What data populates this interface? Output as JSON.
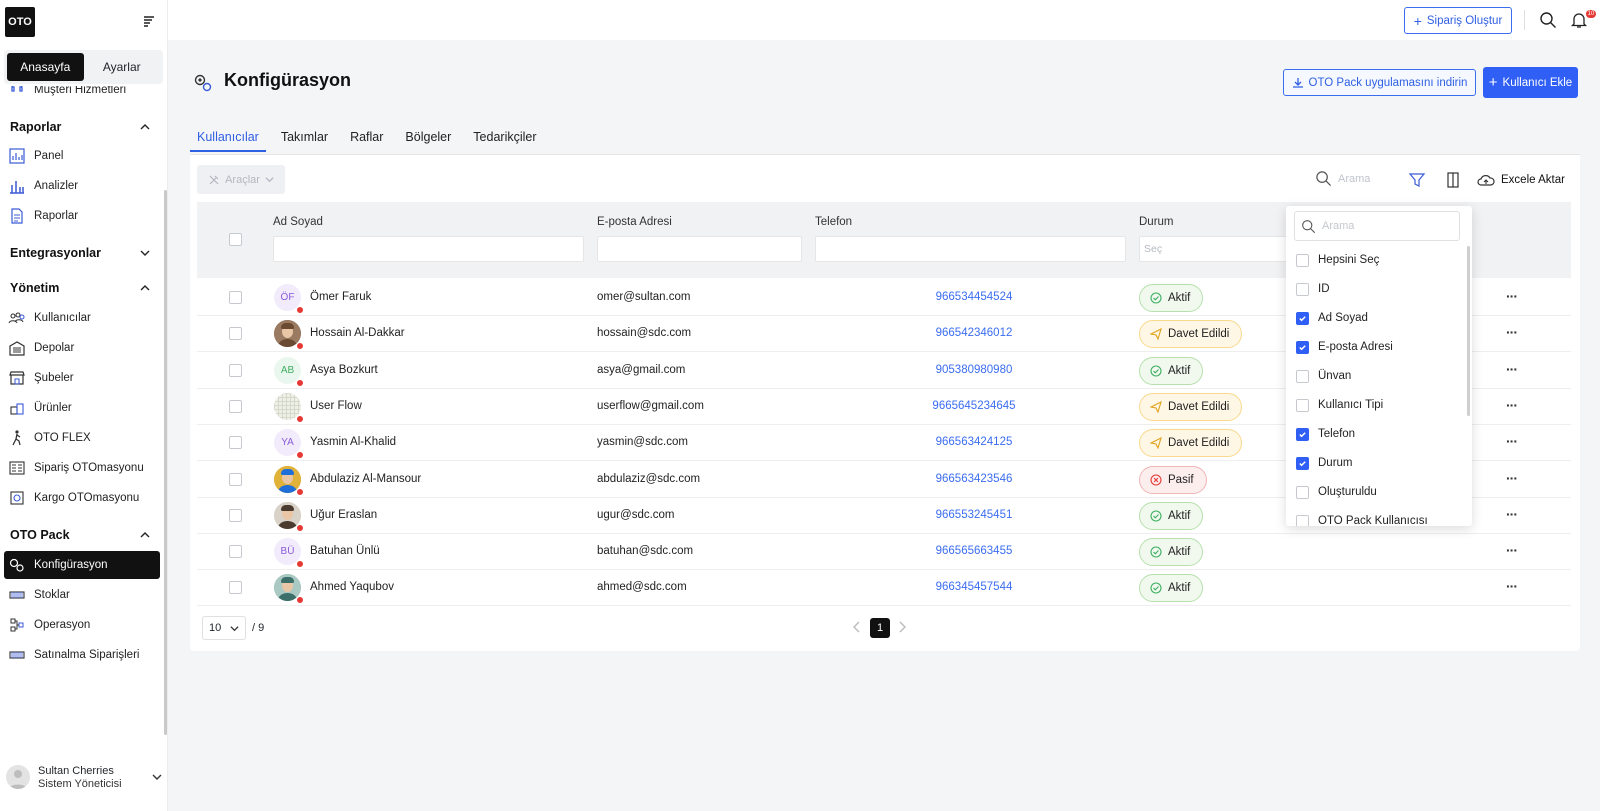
{
  "brand": {
    "logo": "OTO"
  },
  "sidebar": {
    "segments": [
      "Anasayfa",
      "Ayarlar"
    ],
    "partial_item": "Müşteri Hizmetleri",
    "sections": {
      "raporlar": "Raporlar",
      "entegrasyonlar": "Entegrasyonlar",
      "yonetim": "Yönetim",
      "otopack": "OTO Pack"
    },
    "raporlar_items": [
      "Panel",
      "Analizler",
      "Raporlar"
    ],
    "yonetim_items": [
      "Kullanıcılar",
      "Depolar",
      "Şubeler",
      "Ürünler",
      "OTO FLEX",
      "Sipariş OTOmasyonu",
      "Kargo OTOmasyonu"
    ],
    "otopack_items": [
      "Konfigürasyon",
      "Stoklar",
      "Operasyon",
      "Satınalma Siparişleri"
    ],
    "user": {
      "name": "Sultan Cherries",
      "role": "Sistem Yöneticisi"
    }
  },
  "topbar": {
    "create_order": "Sipariş Oluştur",
    "notification_count": "10"
  },
  "page": {
    "title": "Konfigürasyon",
    "download_btn": "OTO Pack uygulamasını indirin",
    "add_user_btn": "Kullanıcı Ekle",
    "tabs": [
      "Kullanıcılar",
      "Takımlar",
      "Raflar",
      "Bölgeler",
      "Tedarikçiler"
    ]
  },
  "toolbar": {
    "tools": "Araçlar",
    "search_placeholder": "Arama",
    "export": "Excele Aktar"
  },
  "table": {
    "headers": {
      "name": "Ad Soyad",
      "email": "E-posta Adresi",
      "phone": "Telefon",
      "status": "Durum"
    },
    "status_placeholder": "Seç",
    "rows": [
      {
        "initials": "ÖF",
        "name": "Ömer Faruk",
        "email": "omer@sultan.com",
        "phone": "966534454524",
        "status": "Aktif",
        "kind": "aktif",
        "avatar": "initials",
        "color": "#8a5cd6",
        "bg": "#f1ebfb"
      },
      {
        "initials": "",
        "name": "Hossain Al-Dakkar",
        "email": "hossain@sdc.com",
        "phone": "966542346012",
        "status": "Davet Edildi",
        "kind": "davet",
        "avatar": "photo",
        "color": "#6b4a32",
        "bg": "#9a7b62"
      },
      {
        "initials": "AB",
        "name": "Asya Bozkurt",
        "email": "asya@gmail.com",
        "phone": "905380980980",
        "status": "Aktif",
        "kind": "aktif",
        "avatar": "initials",
        "color": "#3fae62",
        "bg": "#eaf7ee"
      },
      {
        "initials": "",
        "name": "User Flow",
        "email": "userflow@gmail.com",
        "phone": "9665645234645",
        "status": "Davet Edildi",
        "kind": "davet",
        "avatar": "grid",
        "color": "#cfd3c4",
        "bg": "#eef0e6"
      },
      {
        "initials": "YA",
        "name": "Yasmin Al-Khalid",
        "email": "yasmin@sdc.com",
        "phone": "966563424125",
        "status": "Davet Edildi",
        "kind": "davet",
        "avatar": "initials",
        "color": "#8a5cd6",
        "bg": "#f1ebfb"
      },
      {
        "initials": "",
        "name": "Abdulaziz Al-Mansour",
        "email": "abdulaziz@sdc.com",
        "phone": "966563423546",
        "status": "Pasif",
        "kind": "pasif",
        "avatar": "photo",
        "color": "#1e6fd9",
        "bg": "#e0b23a"
      },
      {
        "initials": "",
        "name": "Uğur Eraslan",
        "email": "ugur@sdc.com",
        "phone": "966553245451",
        "status": "Aktif",
        "kind": "aktif",
        "avatar": "photo",
        "color": "#4a3b2e",
        "bg": "#d9d2c8"
      },
      {
        "initials": "BÜ",
        "name": "Batuhan Ünlü",
        "email": "batuhan@sdc.com",
        "phone": "966565663455",
        "status": "Aktif",
        "kind": "aktif",
        "avatar": "initials",
        "color": "#8a5cd6",
        "bg": "#f1ebfb"
      },
      {
        "initials": "",
        "name": "Ahmed Yaqubov",
        "email": "ahmed@sdc.com",
        "phone": "966345457544",
        "status": "Aktif",
        "kind": "aktif",
        "avatar": "photo",
        "color": "#3c6e6a",
        "bg": "#a9c9c2"
      }
    ]
  },
  "pagination": {
    "page_size": "10",
    "total": "/ 9",
    "current": "1"
  },
  "column_menu": {
    "search_placeholder": "Arama",
    "items": [
      {
        "label": "Hepsini Seç",
        "checked": false
      },
      {
        "label": "ID",
        "checked": false
      },
      {
        "label": "Ad Soyad",
        "checked": true
      },
      {
        "label": "E-posta Adresi",
        "checked": true
      },
      {
        "label": "Ünvan",
        "checked": false
      },
      {
        "label": "Kullanıcı Tipi",
        "checked": false
      },
      {
        "label": "Telefon",
        "checked": true
      },
      {
        "label": "Durum",
        "checked": true
      },
      {
        "label": "Oluşturuldu",
        "checked": false
      },
      {
        "label": "OTO Pack Kullanıcısı",
        "checked": false
      }
    ]
  },
  "colors": {
    "accent": "#2f5ff4",
    "active_nav": "#111111",
    "danger": "#e53935"
  }
}
